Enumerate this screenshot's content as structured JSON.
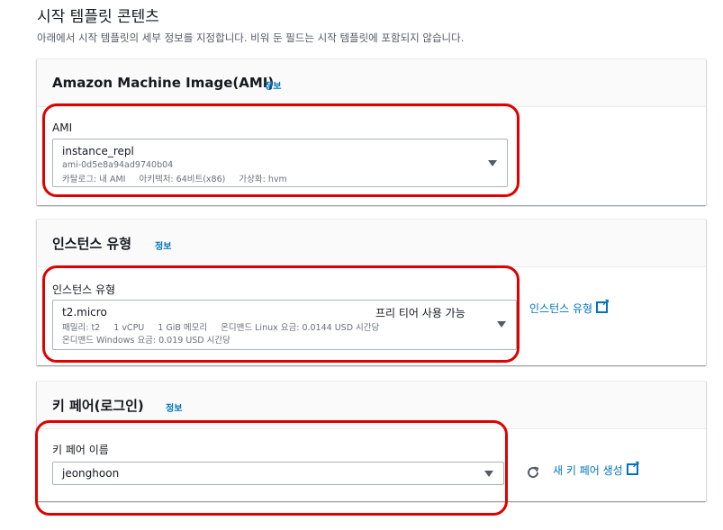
{
  "page": {
    "title": "시작 템플릿 콘텐츠",
    "description": "아래에서 시작 템플릿의 세부 정보를 지정합니다. 비워 둔 필드는 시작 템플릿에 포함되지 않습니다."
  },
  "ami_section": {
    "title": "Amazon Machine Image(AMI)",
    "info_link": "정보",
    "field_label": "AMI",
    "selected": {
      "name": "instance_repl",
      "id": "ami-0d5e8a94ad9740b04",
      "catalog": "카탈로그: 내 AMI",
      "architecture": "아키텍처: 64비트(x86)",
      "virtualization": "가상화: hvm"
    }
  },
  "instance_type_section": {
    "title": "인스턴스 유형",
    "info_link": "정보",
    "field_label": "인스턴스 유형",
    "selected": {
      "name": "t2.micro",
      "free_tier": "프리 티어 사용 가능",
      "family": "패밀리: t2",
      "vcpu": "1 vCPU",
      "memory": "1 GiB 메모리",
      "linux_price": "온디맨드 Linux 요금: 0.0144 USD 시간당",
      "windows_price": "온디맨드 Windows 요금: 0.019 USD 시간당"
    },
    "compare_link": "인스턴스 유형"
  },
  "keypair_section": {
    "title": "키 페어(로그인)",
    "info_link": "정보",
    "field_label": "키 페어 이름",
    "selected": "jeonghoon",
    "create_link": "새 키 페어 생성"
  },
  "colors": {
    "link": "#0073bb",
    "highlight": "#e00000",
    "border": "#aab7b8"
  }
}
